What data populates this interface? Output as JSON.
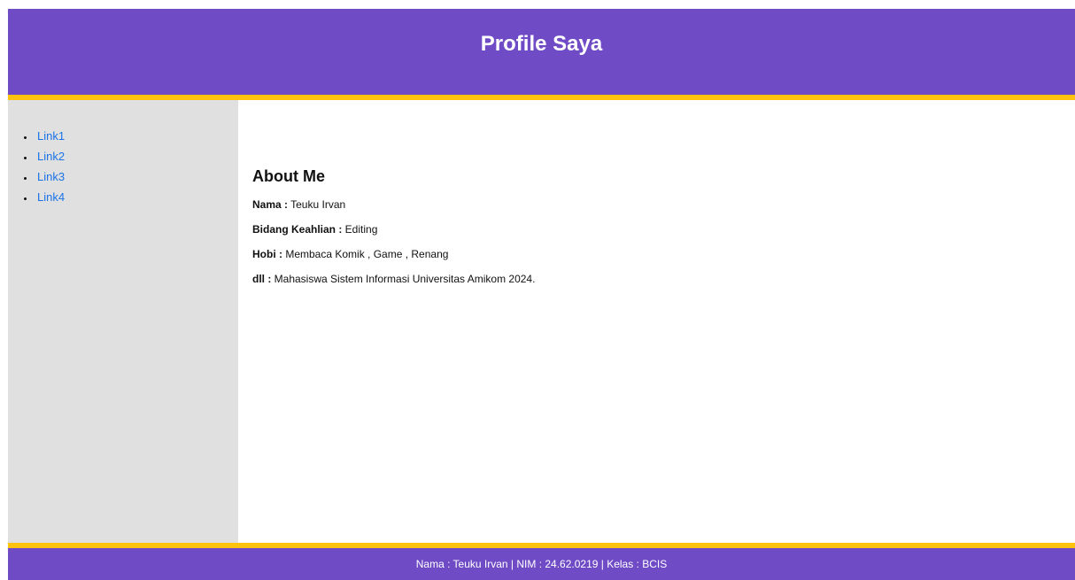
{
  "header": {
    "title": "Profile Saya"
  },
  "sidebar": {
    "links": [
      {
        "label": "Link1"
      },
      {
        "label": "Link2"
      },
      {
        "label": "Link3"
      },
      {
        "label": "Link4"
      }
    ]
  },
  "main": {
    "heading": "About Me",
    "rows": [
      {
        "label": "Nama :",
        "value": " Teuku Irvan"
      },
      {
        "label": "Bidang Keahlian :",
        "value": " Editing"
      },
      {
        "label": "Hobi :",
        "value": " Membaca Komik , Game , Renang"
      },
      {
        "label": "dll :",
        "value": " Mahasiswa Sistem Informasi Universitas Amikom 2024."
      }
    ]
  },
  "footer": {
    "text": "Nama : Teuku Irvan | NIM : 24.62.0219 | Kelas : BCIS"
  },
  "colors": {
    "header_bg": "#6f4bc6",
    "accent_border": "#ffc20e",
    "sidebar_bg": "#e0e0e0",
    "link": "#1a73e8"
  }
}
